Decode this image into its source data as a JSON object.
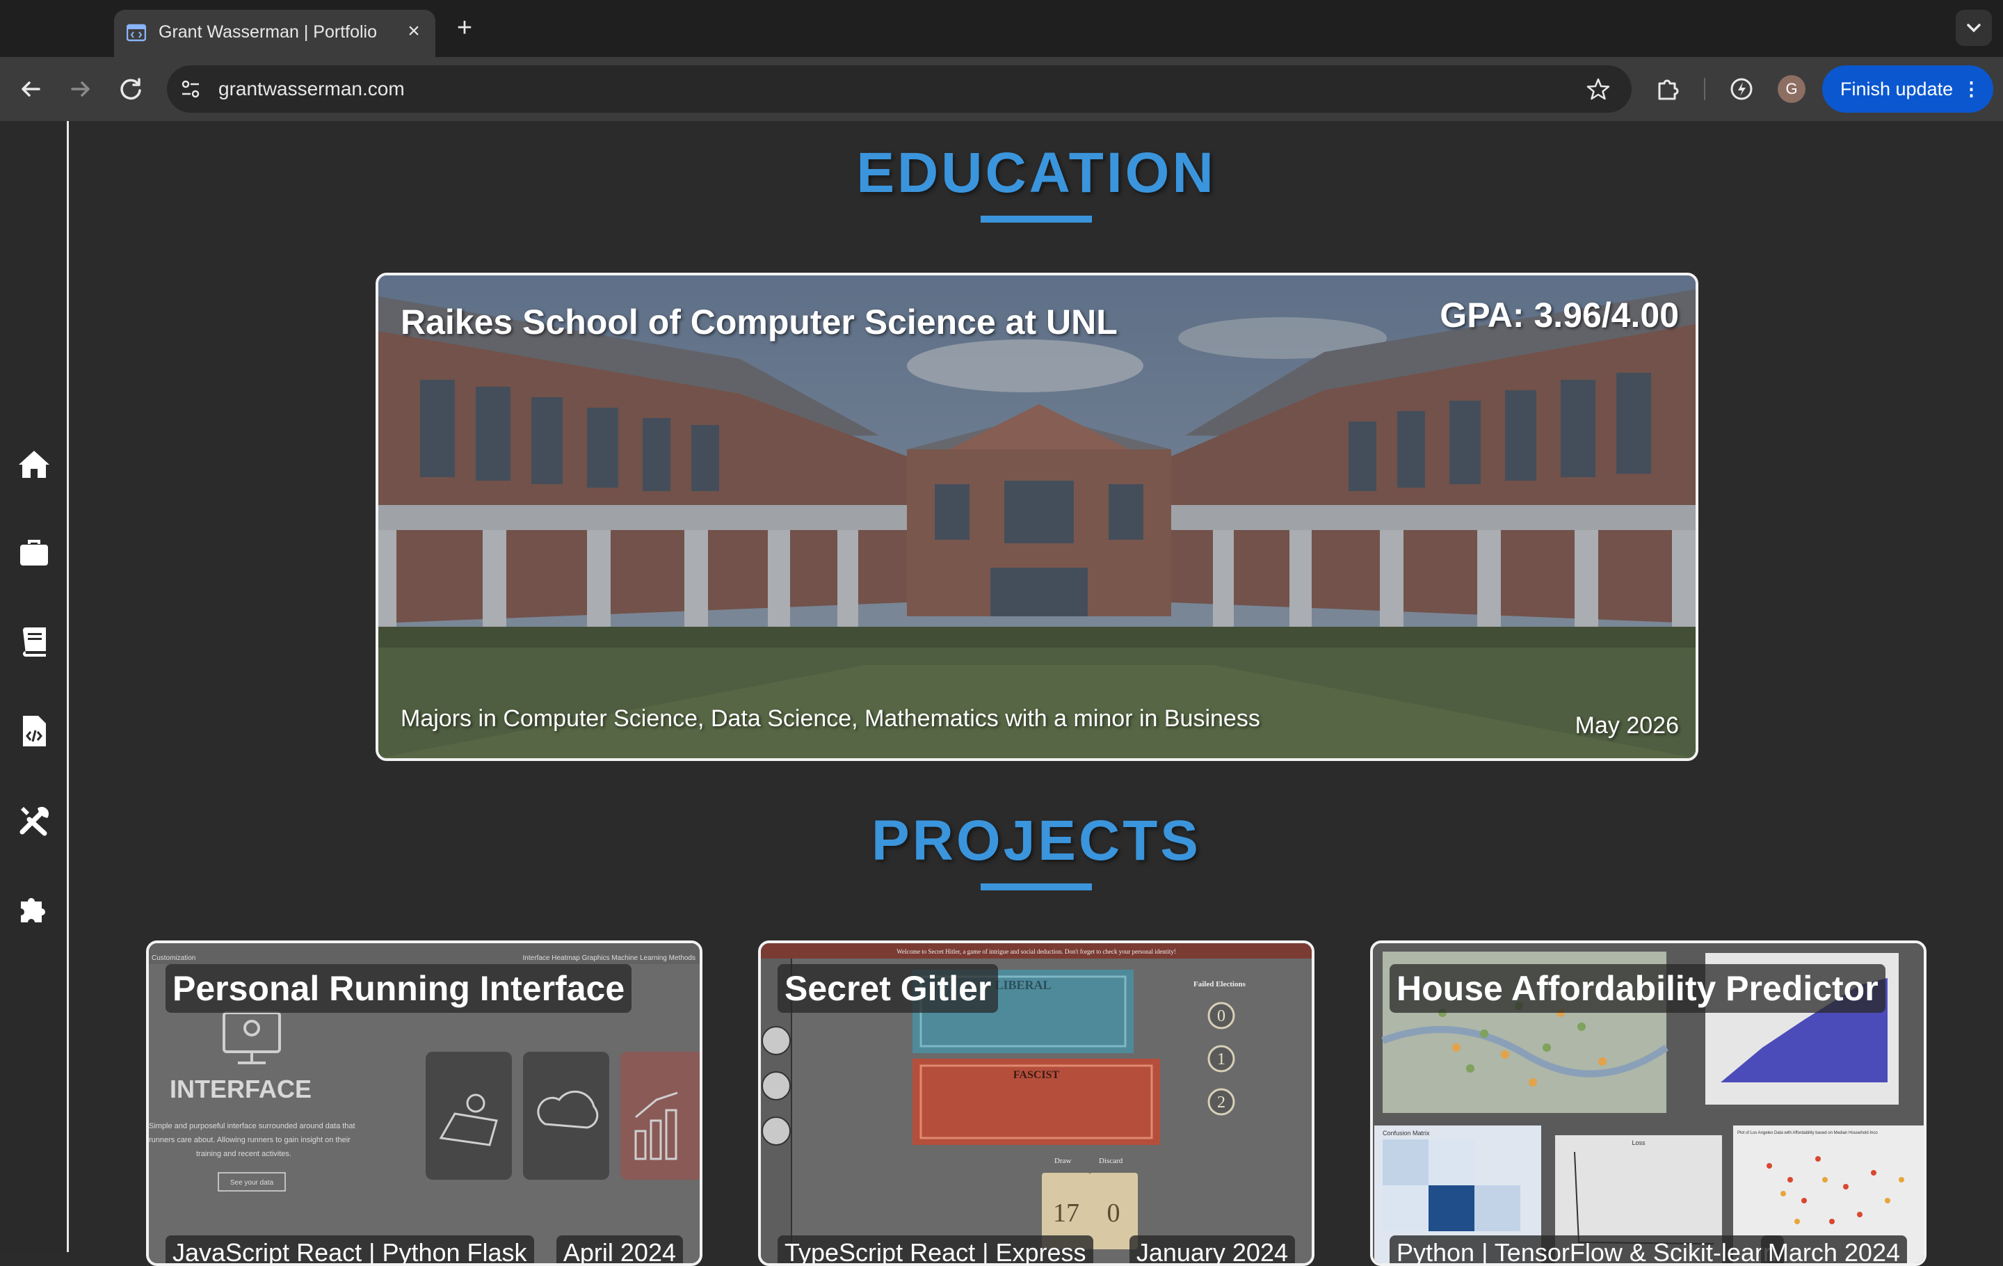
{
  "browser": {
    "tab_title": "Grant Wasserman | Portfolio",
    "tab_close": "×",
    "new_tab": "+",
    "url": "grantwasserman.com",
    "profile_initial": "G",
    "finish_update": "Finish update",
    "menu_dots": "⋮"
  },
  "sidebar": {
    "items": [
      {
        "icon": "home-icon"
      },
      {
        "icon": "briefcase-icon"
      },
      {
        "icon": "book-icon"
      },
      {
        "icon": "code-file-icon"
      },
      {
        "icon": "tools-icon"
      },
      {
        "icon": "puzzle-icon"
      }
    ]
  },
  "education": {
    "heading": "EDUCATION",
    "school": "Raikes School of Computer Science at UNL",
    "gpa": "GPA: 3.96/4.00",
    "majors": "Majors in Computer Science, Data Science, Mathematics with a minor in Business",
    "date": "May 2026"
  },
  "projects": {
    "heading": "PROJECTS",
    "items": [
      {
        "title": "Personal Running Interface",
        "tech": "JavaScript React | Python Flask",
        "date": "April 2024",
        "preview": {
          "brand": "Customization",
          "nav": "Interface  Heatmap  Graphics  Machine Learning  Methods",
          "heading": "INTERFACE",
          "body_line1": "Simple and purposeful interface surrounded around data that",
          "body_line2": "runners care about. Allowing runners to gain insight on their",
          "body_line3": "training and recent activites.",
          "button": "See your data"
        }
      },
      {
        "title": "Secret Gitler",
        "tech": "TypeScript React | Express",
        "date": "January 2024",
        "preview": {
          "banner": "Welcome to Secret Hitler, a game of intrigue and social deduction. Don't forget to check your personal identity!",
          "liberal": "LIBERAL",
          "fascist": "FASCIST",
          "failed_elections": "Failed Elections",
          "counter": [
            "0",
            "1",
            "2"
          ],
          "draw_label": "Draw",
          "discard_label": "Discard",
          "draw_count": "17",
          "discard_count": "0"
        }
      },
      {
        "title": "House Affordability Predictor",
        "tech": "Python | TensorFlow & Scikit-learn",
        "date": "March 2024",
        "preview": {
          "matrix_title": "Confusion Matrix",
          "loss_title": "Loss",
          "scatter_title": "Plot of Los Angeles Data with Affordability based on Median Household Inco"
        }
      }
    ]
  },
  "colors": {
    "accent": "#3b95dc",
    "background": "#2b2b2b",
    "update_button": "#0b57d0"
  }
}
